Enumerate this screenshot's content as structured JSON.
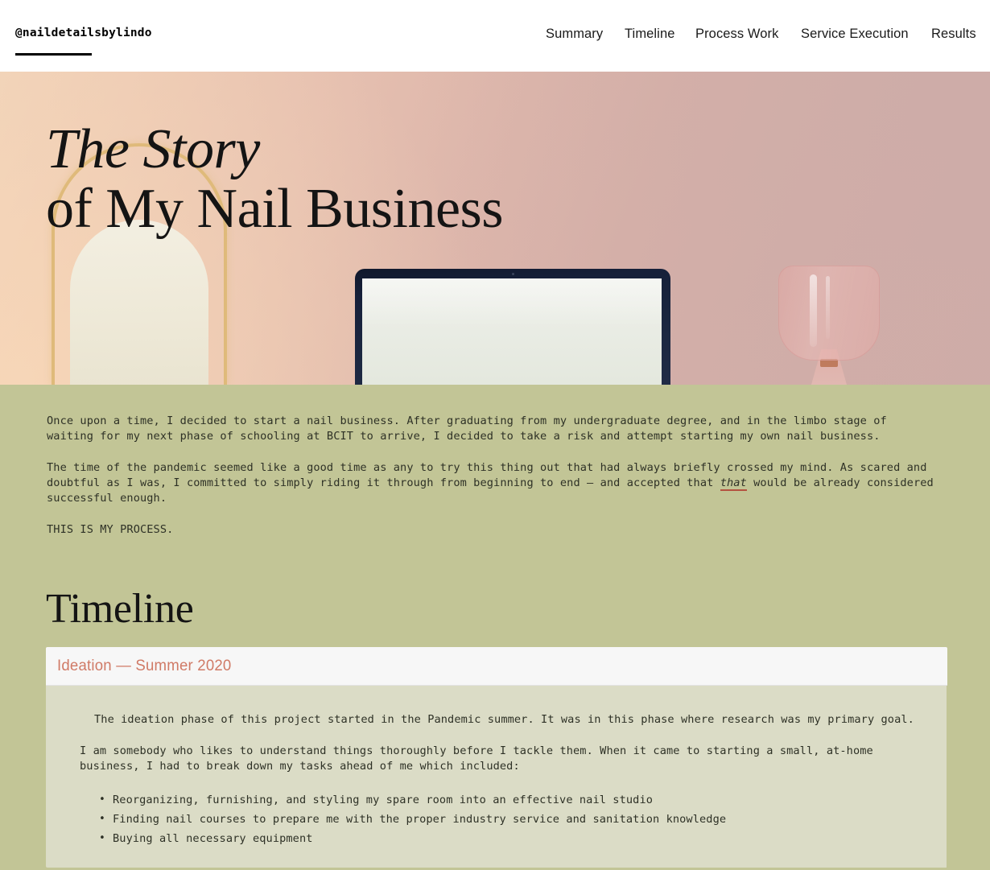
{
  "header": {
    "brand": "@naildetailsbylindo",
    "nav": [
      {
        "label": "Summary"
      },
      {
        "label": "Timeline"
      },
      {
        "label": "Process Work"
      },
      {
        "label": "Service Execution"
      },
      {
        "label": "Results"
      }
    ]
  },
  "hero": {
    "title_line1": "The Story",
    "title_line2": "of My Nail Business",
    "decor": {
      "arch": "gold-arch-decoration",
      "laptop": "laptop-photo-element",
      "glass": "pink-glass-vessel-photo-element"
    },
    "colors": {
      "gradient_from": "#f0d2b9",
      "gradient_to": "#cfaca7",
      "arch_gold": "#dfba7a"
    }
  },
  "intro": {
    "paragraph_1": "Once upon a time, I decided to start a nail business. After graduating from my undergraduate degree, and in the limbo stage of waiting for my next phase of schooling at BCIT to arrive, I decided to take a risk and attempt starting my own nail business.",
    "paragraph_2_part1": "The time of the pandemic seemed like a good time as any to try this thing out that had always briefly crossed my mind. As scared and doubtful as I was, I committed to simply riding it through from beginning to end — and accepted that ",
    "paragraph_2_emphasis": "that",
    "paragraph_2_part2": " would be already considered successful enough.",
    "process_caps": "THIS IS MY PROCESS."
  },
  "timeline": {
    "heading": "Timeline",
    "card": {
      "title": "Ideation — Summer 2020",
      "paragraph_1": "The ideation phase of this project started in the Pandemic summer. It was in this phase where research was my primary goal.",
      "paragraph_2": "I am somebody who likes to understand things thoroughly before I tackle them. When it came to starting a small, at-home business, I had to break down my tasks ahead of me which included:",
      "bullets": [
        "Reorganizing, furnishing, and styling my spare room into an effective nail studio",
        "Finding nail courses to prepare me with the proper industry service and sanitation knowledge",
        "Buying all necessary equipment"
      ],
      "colors": {
        "title": "#d07a66",
        "header_bg": "#f7f7f7",
        "body_bg": "#dbdcc6"
      }
    }
  },
  "page": {
    "background": "#c2c596",
    "text_color": "#2e3126",
    "muted_text_color": "#8b8d70",
    "accent_underline": "#b4523f"
  }
}
